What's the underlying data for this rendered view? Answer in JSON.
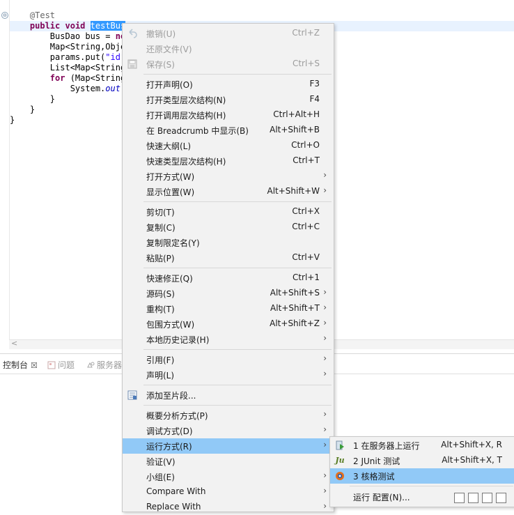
{
  "editor": {
    "lines": [
      {
        "indent": "    ",
        "parts": [
          {
            "t": "@Test",
            "c": "ann"
          }
        ]
      },
      {
        "indent": "    ",
        "parts": [
          {
            "t": "public",
            "c": "kw"
          },
          {
            "t": " "
          },
          {
            "t": "void",
            "c": "kw"
          },
          {
            "t": " "
          },
          {
            "t": "testBus",
            "c": "sel"
          }
        ]
      },
      {
        "indent": "        ",
        "parts": [
          {
            "t": "BusDao bus = "
          },
          {
            "t": "ne",
            "c": "kw"
          }
        ]
      },
      {
        "indent": "        ",
        "parts": [
          {
            "t": "Map<String,Obje"
          }
        ]
      },
      {
        "indent": "        ",
        "parts": [
          {
            "t": "params.put("
          },
          {
            "t": "\"id\"",
            "c": "str"
          }
        ]
      },
      {
        "indent": "        ",
        "parts": [
          {
            "t": "List<Map<String"
          }
        ]
      },
      {
        "indent": "        ",
        "parts": [
          {
            "t": "for",
            "c": "kw"
          },
          {
            "t": " (Map<String"
          }
        ]
      },
      {
        "indent": "            ",
        "parts": [
          {
            "t": "System."
          },
          {
            "t": "out",
            "c": "ital"
          },
          {
            "t": "."
          }
        ]
      },
      {
        "indent": "        ",
        "parts": [
          {
            "t": "}"
          }
        ]
      },
      {
        "indent": "    ",
        "parts": [
          {
            "t": "}"
          }
        ]
      },
      {
        "indent": "",
        "parts": [
          {
            "t": "}"
          }
        ]
      }
    ],
    "fold_marker": "⊖",
    "scroll_left_arrow": "<"
  },
  "panel": {
    "tabs": [
      {
        "label": "控制台",
        "close": "☒"
      },
      {
        "label": "问题"
      },
      {
        "label": "服务器"
      }
    ]
  },
  "menu": {
    "items": [
      {
        "label": "撤销(U)",
        "shortcut": "Ctrl+Z",
        "disabled": true,
        "icon": "undo-icon"
      },
      {
        "label": "还原文件(V)",
        "disabled": true
      },
      {
        "label": "保存(S)",
        "shortcut": "Ctrl+S",
        "disabled": true,
        "icon": "save-icon"
      },
      {
        "sep": true
      },
      {
        "label": "打开声明(O)",
        "shortcut": "F3"
      },
      {
        "label": "打开类型层次结构(N)",
        "shortcut": "F4"
      },
      {
        "label": "打开调用层次结构(H)",
        "shortcut": "Ctrl+Alt+H"
      },
      {
        "label": "在 Breadcrumb 中显示(B)",
        "shortcut": "Alt+Shift+B"
      },
      {
        "label": "快速大纲(L)",
        "shortcut": "Ctrl+O"
      },
      {
        "label": "快速类型层次结构(H)",
        "shortcut": "Ctrl+T"
      },
      {
        "label": "打开方式(W)",
        "submenu": true
      },
      {
        "label": "显示位置(W)",
        "shortcut": "Alt+Shift+W",
        "submenu": true
      },
      {
        "sep": true
      },
      {
        "label": "剪切(T)",
        "shortcut": "Ctrl+X"
      },
      {
        "label": "复制(C)",
        "shortcut": "Ctrl+C"
      },
      {
        "label": "复制限定名(Y)"
      },
      {
        "label": "粘贴(P)",
        "shortcut": "Ctrl+V"
      },
      {
        "sep": true
      },
      {
        "label": "快速修正(Q)",
        "shortcut": "Ctrl+1"
      },
      {
        "label": "源码(S)",
        "shortcut": "Alt+Shift+S",
        "submenu": true
      },
      {
        "label": "重构(T)",
        "shortcut": "Alt+Shift+T",
        "submenu": true
      },
      {
        "label": "包围方式(W)",
        "shortcut": "Alt+Shift+Z",
        "submenu": true
      },
      {
        "label": "本地历史记录(H)",
        "submenu": true
      },
      {
        "sep": true
      },
      {
        "label": "引用(F)",
        "submenu": true
      },
      {
        "label": "声明(L)",
        "submenu": true
      },
      {
        "sep": true
      },
      {
        "label": "添加至片段...",
        "icon": "snippet-icon"
      },
      {
        "sep": true
      },
      {
        "label": "概要分析方式(P)",
        "submenu": true
      },
      {
        "label": "调试方式(D)",
        "submenu": true
      },
      {
        "label": "运行方式(R)",
        "submenu": true,
        "highlighted": true
      },
      {
        "label": "验证(V)"
      },
      {
        "label": "小组(E)",
        "submenu": true
      },
      {
        "label": "Compare With",
        "submenu": true
      },
      {
        "label": "Replace With",
        "submenu": true
      }
    ],
    "submenu_arrow": "›"
  },
  "submenu": {
    "items": [
      {
        "label": "1 在服务器上运行",
        "shortcut": "Alt+Shift+X, R",
        "icon": "server-run-icon"
      },
      {
        "label": "2 JUnit 测试",
        "shortcut": "Alt+Shift+X, T",
        "icon": "junit-icon",
        "icon_text": "Ju"
      },
      {
        "label": "3 核格测试",
        "highlighted": true,
        "icon": "gear-icon"
      },
      {
        "sep": true
      },
      {
        "label": "运行 配置(N)..."
      }
    ]
  },
  "colors": {
    "menu_highlight": "#91c9f7",
    "selection": "#3399ff"
  }
}
